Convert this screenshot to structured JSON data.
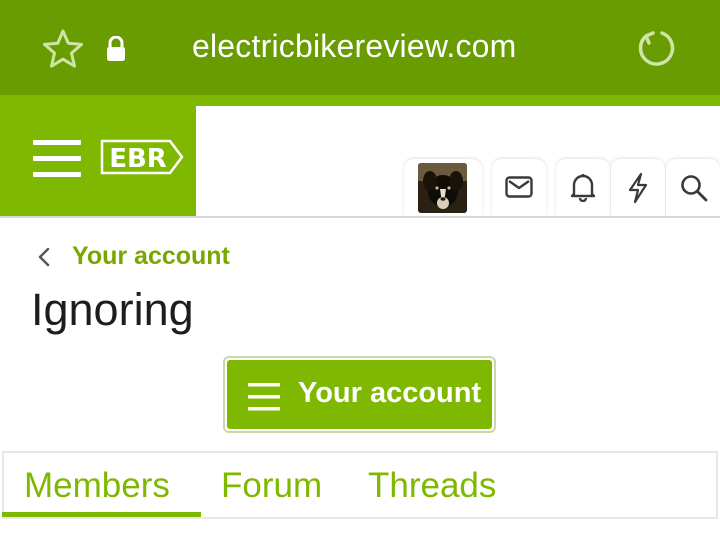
{
  "browser": {
    "url": "electricbikereview.com",
    "icons": [
      "star-icon",
      "lock-icon",
      "reload-icon"
    ],
    "toolbar_color": "#699c00"
  },
  "site_header": {
    "logo_text": "EBR",
    "brand_color": "#7fb800",
    "nav_icons": [
      "avatar",
      "envelope-icon",
      "bell-icon",
      "lightning-icon",
      "search-icon"
    ]
  },
  "breadcrumb": {
    "label": "Your account"
  },
  "page": {
    "title": "Ignoring",
    "account_button_label": "Your account"
  },
  "tabs": {
    "items": [
      "Members",
      "Forum",
      "Threads"
    ],
    "active": "Members"
  }
}
